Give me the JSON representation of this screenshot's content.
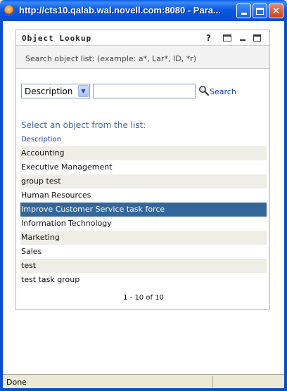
{
  "window": {
    "title": "http://cts10.qalab.wal.novell.com:8080 - Para..."
  },
  "panel": {
    "title": "Object Lookup",
    "instructions": "Search object list: (example: a*, Lar*, ID, *r)",
    "search": {
      "field_selected": "Description",
      "query_value": "",
      "button_label": "Search"
    },
    "list_caption": "Select an object from the list:",
    "column_header": "Description",
    "rows": [
      {
        "label": "Accounting",
        "selected": false
      },
      {
        "label": "Executive Management",
        "selected": false
      },
      {
        "label": "group test",
        "selected": false
      },
      {
        "label": "Human Resources",
        "selected": false
      },
      {
        "label": "Improve Customer Service task force",
        "selected": true
      },
      {
        "label": "Information Technology",
        "selected": false
      },
      {
        "label": "Marketing",
        "selected": false
      },
      {
        "label": "Sales",
        "selected": false
      },
      {
        "label": "test",
        "selected": false
      },
      {
        "label": "test task group",
        "selected": false
      }
    ],
    "pager": "1 - 10 of 10"
  },
  "statusbar": {
    "text": "Done"
  },
  "colors": {
    "selected_row": "#336699",
    "link": "#0b3aa8",
    "caption": "#3d6aa6"
  },
  "icons": {
    "app": "firefox-icon",
    "help": "help-icon",
    "print": "print-icon",
    "minimize": "minimize-icon",
    "maximize": "maximize-icon",
    "search": "magnifier-icon"
  }
}
